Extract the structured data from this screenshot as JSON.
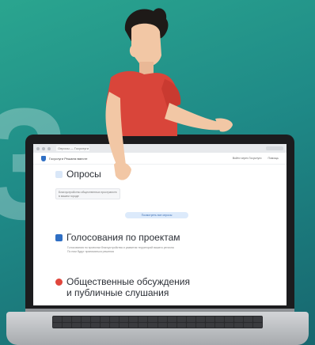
{
  "background_digit": "3",
  "colors": {
    "background_top": "#2aa58f",
    "background_bottom": "#17676f",
    "shirt": "#d9453a",
    "skin": "#f2c7a5",
    "hair": "#1e1a18",
    "accent_blue": "#2f6fc4",
    "accent_red": "#e0463c"
  },
  "browser": {
    "tab_label": "Опросы — Госуслуги"
  },
  "site": {
    "name": "Госуслуги Решаем вместе",
    "header_links": [
      "Войти через Госуслуги",
      "Помощь"
    ]
  },
  "sections": {
    "polls": {
      "title": "Опросы",
      "card_text": "Благоустройство общественных пространств в вашем городе",
      "more_button": "Посмотреть все опросы"
    },
    "voting": {
      "title": "Голосования по проектам",
      "description_line1": "Голосования по проектам благоустройства и развития территорий вашего региона",
      "description_line2": "По ним будут приниматься решения"
    },
    "discussions": {
      "title_line1": "Общественные обсуждения",
      "title_line2": "и публичные слушания"
    }
  }
}
